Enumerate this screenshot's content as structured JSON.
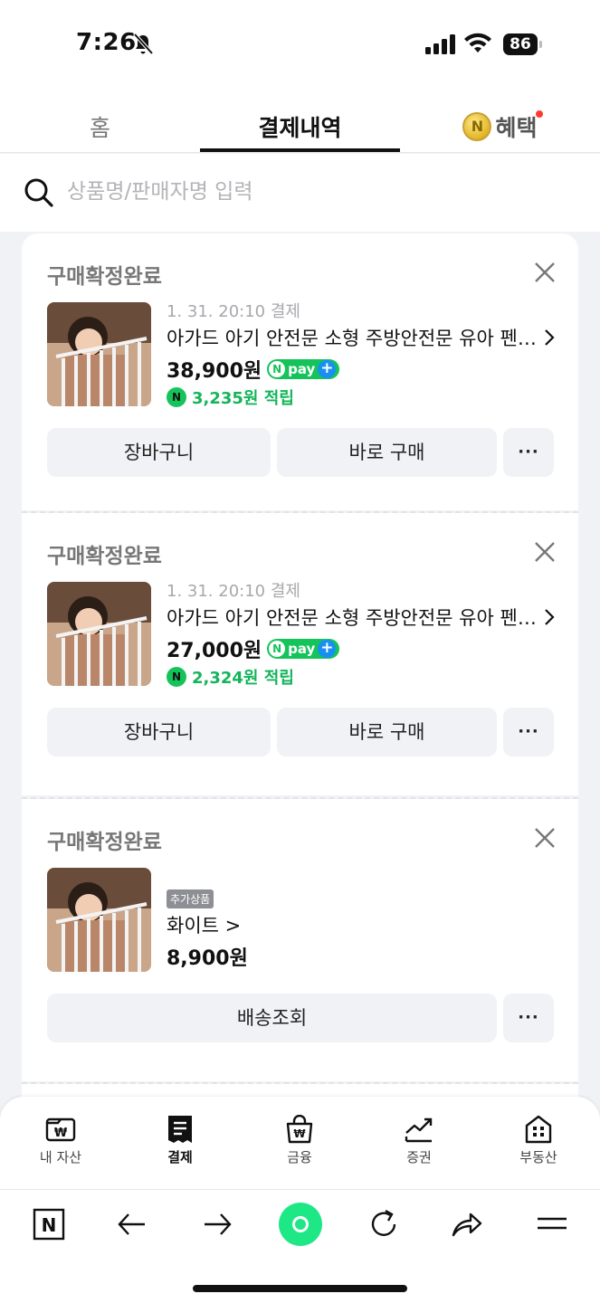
{
  "status_bar": {
    "time": "7:26",
    "battery": "86"
  },
  "tabs": {
    "home": "홈",
    "payments": "결제내역",
    "benefits": "혜택"
  },
  "search": {
    "placeholder": "상품명/판매자명 입력"
  },
  "orders": [
    {
      "status": "구매확정완료",
      "date": "1. 31. 20:10 결제",
      "product": "아가드 아기 안전문 소형 주방안전문 유아 펜스 베이비",
      "price": "38,900원",
      "npay_label": "pay",
      "points": "3,235원 적립",
      "buttons": {
        "cart": "장바구니",
        "buy": "바로 구매",
        "more": "···"
      }
    },
    {
      "status": "구매확정완료",
      "date": "1. 31. 20:10 결제",
      "product": "아가드 아기 안전문 소형 주방안전문 유아 펜스 베이비",
      "price": "27,000원",
      "npay_label": "pay",
      "points": "2,324원 적립",
      "buttons": {
        "cart": "장바구니",
        "buy": "바로 구매",
        "more": "···"
      }
    },
    {
      "status": "구매확정완료",
      "tag": "추가상품",
      "option": "화이트 >",
      "price": "8,900원",
      "buttons": {
        "track": "배송조회",
        "more": "···"
      }
    }
  ],
  "bottom_nav": [
    {
      "label": "내 자산",
      "icon": "wallet-icon"
    },
    {
      "label": "결제",
      "icon": "receipt-icon",
      "active": true
    },
    {
      "label": "금융",
      "icon": "bag-icon"
    },
    {
      "label": "증권",
      "icon": "chart-icon"
    },
    {
      "label": "부동산",
      "icon": "building-icon"
    }
  ],
  "colors": {
    "accent_green": "#14c45b",
    "text_muted": "#777777"
  }
}
